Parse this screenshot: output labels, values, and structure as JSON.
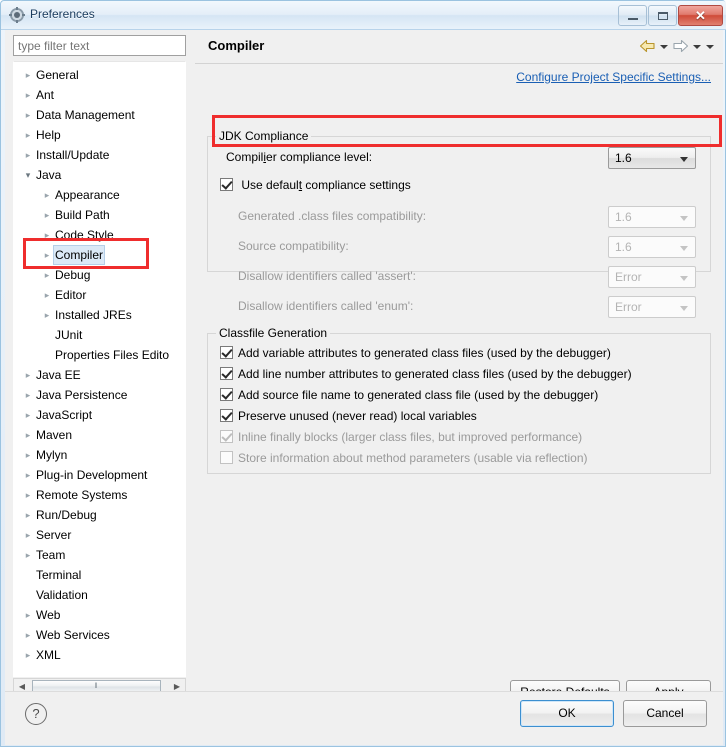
{
  "window": {
    "title": "Preferences",
    "icon": "preferences-gear-icon",
    "minimize_label": "Minimize",
    "maximize_label": "Maximize",
    "close_label": "✕"
  },
  "sidebar": {
    "filter_placeholder": "type filter text",
    "filter_value": "",
    "scroll_thumb_grip": "‖",
    "scroll_left_arrow": "◀",
    "scroll_right_arrow": "▶",
    "items": [
      {
        "label": "General",
        "indent": 1,
        "twisty": "collapsed",
        "selected": false
      },
      {
        "label": "Ant",
        "indent": 1,
        "twisty": "collapsed",
        "selected": false
      },
      {
        "label": "Data Management",
        "indent": 1,
        "twisty": "collapsed",
        "selected": false
      },
      {
        "label": "Help",
        "indent": 1,
        "twisty": "collapsed",
        "selected": false
      },
      {
        "label": "Install/Update",
        "indent": 1,
        "twisty": "collapsed",
        "selected": false
      },
      {
        "label": "Java",
        "indent": 1,
        "twisty": "expanded",
        "selected": false
      },
      {
        "label": "Appearance",
        "indent": 2,
        "twisty": "collapsed",
        "selected": false
      },
      {
        "label": "Build Path",
        "indent": 2,
        "twisty": "collapsed",
        "selected": false
      },
      {
        "label": "Code Style",
        "indent": 2,
        "twisty": "collapsed",
        "selected": false
      },
      {
        "label": "Compiler",
        "indent": 2,
        "twisty": "collapsed",
        "selected": true
      },
      {
        "label": "Debug",
        "indent": 2,
        "twisty": "collapsed",
        "selected": false
      },
      {
        "label": "Editor",
        "indent": 2,
        "twisty": "collapsed",
        "selected": false
      },
      {
        "label": "Installed JREs",
        "indent": 2,
        "twisty": "collapsed",
        "selected": false
      },
      {
        "label": "JUnit",
        "indent": 2,
        "twisty": "none",
        "selected": false
      },
      {
        "label": "Properties Files Edito",
        "indent": 2,
        "twisty": "none",
        "selected": false
      },
      {
        "label": "Java EE",
        "indent": 1,
        "twisty": "collapsed",
        "selected": false
      },
      {
        "label": "Java Persistence",
        "indent": 1,
        "twisty": "collapsed",
        "selected": false
      },
      {
        "label": "JavaScript",
        "indent": 1,
        "twisty": "collapsed",
        "selected": false
      },
      {
        "label": "Maven",
        "indent": 1,
        "twisty": "collapsed",
        "selected": false
      },
      {
        "label": "Mylyn",
        "indent": 1,
        "twisty": "collapsed",
        "selected": false
      },
      {
        "label": "Plug-in Development",
        "indent": 1,
        "twisty": "collapsed",
        "selected": false
      },
      {
        "label": "Remote Systems",
        "indent": 1,
        "twisty": "collapsed",
        "selected": false
      },
      {
        "label": "Run/Debug",
        "indent": 1,
        "twisty": "collapsed",
        "selected": false
      },
      {
        "label": "Server",
        "indent": 1,
        "twisty": "collapsed",
        "selected": false
      },
      {
        "label": "Team",
        "indent": 1,
        "twisty": "collapsed",
        "selected": false
      },
      {
        "label": "Terminal",
        "indent": 1,
        "twisty": "none",
        "selected": false
      },
      {
        "label": "Validation",
        "indent": 1,
        "twisty": "none",
        "selected": false
      },
      {
        "label": "Web",
        "indent": 1,
        "twisty": "collapsed",
        "selected": false
      },
      {
        "label": "Web Services",
        "indent": 1,
        "twisty": "collapsed",
        "selected": false
      },
      {
        "label": "XML",
        "indent": 1,
        "twisty": "collapsed",
        "selected": false
      }
    ]
  },
  "page": {
    "title": "Compiler",
    "back_icon": "back-arrow-icon",
    "forward_icon": "forward-arrow-icon",
    "menu_icon": "chevron-down-icon",
    "project_settings_link": "Configure Project Specific Settings..."
  },
  "jdk_compliance": {
    "group_title": "JDK Compliance",
    "compliance_level": {
      "label": "Compiler compliance level:",
      "label_mnemonic": "i",
      "value": "1.6",
      "disabled": false
    },
    "use_default": {
      "label": "Use default compliance settings",
      "label_mnemonic": "t",
      "checked": true,
      "disabled": false
    },
    "rows": [
      {
        "label": "Generated .class files compatibility:",
        "mnemonic": "n",
        "value": "1.6",
        "disabled": true
      },
      {
        "label": "Source compatibility:",
        "mnemonic": "m",
        "value": "1.6",
        "disabled": true
      },
      {
        "label": "Disallow identifiers called 'assert':",
        "mnemonic": "r",
        "value": "Error",
        "disabled": true
      },
      {
        "label": "Disallow identifiers called 'enum':",
        "mnemonic": "w",
        "value": "Error",
        "disabled": true
      }
    ]
  },
  "classfile_generation": {
    "group_title": "Classfile Generation",
    "checkboxes": [
      {
        "label": "Add variable attributes to generated class files (used by the debugger)",
        "mnemonic": "b",
        "checked": true,
        "disabled": false
      },
      {
        "label": "Add line number attributes to generated class files (used by the debugger)",
        "mnemonic": "l",
        "checked": true,
        "disabled": false
      },
      {
        "label": "Add source file name to generated class file (used by the debugger)",
        "mnemonic": "f",
        "checked": true,
        "disabled": false
      },
      {
        "label": "Preserve unused (never read) local variables",
        "mnemonic": "e",
        "checked": true,
        "disabled": false
      },
      {
        "label": "Inline finally blocks (larger class files, but improved performance)",
        "mnemonic": "c",
        "checked": true,
        "disabled": true
      },
      {
        "label": "Store information about method parameters (usable via reflection)",
        "mnemonic": "S",
        "checked": false,
        "disabled": true
      }
    ]
  },
  "buttons": {
    "restore_defaults": "Restore Defaults",
    "restore_defaults_mnemonic": "D",
    "apply": "Apply",
    "apply_mnemonic": "A",
    "ok": "OK",
    "cancel": "Cancel",
    "help_icon": "?"
  },
  "annotations": {
    "accent_color": "#ef2d2d",
    "highlight_tree_item": "Compiler",
    "highlight_field": "Compiler compliance level:"
  }
}
